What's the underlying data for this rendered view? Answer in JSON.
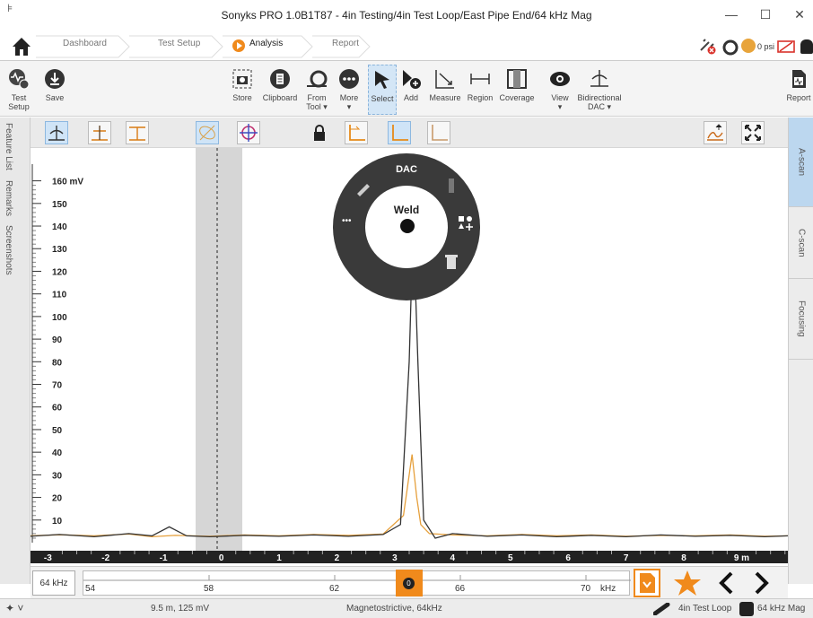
{
  "window": {
    "title": "Sonyks PRO 1.0B1T87 - 4in Testing/4in Test Loop/East Pipe End/64 kHz Mag",
    "system_menu_glyph": "̅"
  },
  "nav": {
    "home_icon": "home-icon",
    "crumbs": [
      "Dashboard",
      "Test Setup",
      "Analysis",
      "Report"
    ],
    "active": "Analysis",
    "pressure": "0 psi"
  },
  "ribbon": {
    "left": [
      {
        "label": "Test\nSetup",
        "icon": "test-setup-icon"
      },
      {
        "label": "Save",
        "icon": "save-icon"
      }
    ],
    "middle": [
      {
        "label": "Store",
        "icon": "store-icon"
      },
      {
        "label": "Clipboard",
        "icon": "clipboard-icon"
      },
      {
        "label": "From\nTool ▾",
        "icon": "from-tool-icon"
      },
      {
        "label": "More\n▾",
        "icon": "more-icon"
      },
      {
        "label": "Select",
        "icon": "select-icon"
      },
      {
        "label": "Add",
        "icon": "add-icon"
      },
      {
        "label": "Measure",
        "icon": "measure-icon"
      },
      {
        "label": "Region",
        "icon": "region-icon"
      },
      {
        "label": "Coverage",
        "icon": "coverage-icon"
      },
      {
        "label": "View\n▾",
        "icon": "view-icon"
      },
      {
        "label": "Bidirectional\nDAC ▾",
        "icon": "dac-icon"
      }
    ],
    "right": [
      {
        "label": "Report",
        "icon": "report-icon"
      }
    ]
  },
  "side_tabs": {
    "left": [
      "Feature List",
      "Remarks",
      "Screenshots"
    ],
    "right": [
      "A-scan",
      "C-scan",
      "Focusing"
    ]
  },
  "chart_data": {
    "type": "line",
    "ylabel": "",
    "yunit": "mV",
    "yticks": [
      10,
      20,
      30,
      40,
      50,
      60,
      70,
      80,
      90,
      100,
      110,
      120,
      130,
      140,
      150,
      160
    ],
    "ylim": [
      0,
      165
    ],
    "xunit": "m",
    "xticks": [
      -3,
      -2,
      -1,
      0,
      1,
      2,
      3,
      4,
      5,
      6,
      7,
      8,
      9
    ],
    "xlim": [
      -3.3,
      9.8
    ],
    "series": [
      {
        "color": "#e6a03c",
        "x": [
          -3.3,
          -2.8,
          -2.2,
          -1.6,
          -1.2,
          -0.8,
          -0.2,
          0.4,
          1,
          1.6,
          2.2,
          2.8,
          3.15,
          3.3,
          3.38,
          3.45,
          3.6,
          4,
          4.6,
          5.2,
          5.8,
          6.4,
          7,
          7.6,
          8.2,
          8.8,
          9.4,
          9.8
        ],
        "y": [
          3,
          3.5,
          3,
          3.8,
          2.6,
          3.2,
          2.8,
          3.4,
          3,
          3.6,
          3.2,
          3.8,
          12,
          39,
          20,
          8,
          4,
          3.4,
          3,
          3.6,
          3,
          3.4,
          2.8,
          3.2,
          3,
          3.4,
          2.8,
          3
        ]
      },
      {
        "color": "#333333",
        "x": [
          -3.3,
          -2.8,
          -2.2,
          -1.6,
          -1.2,
          -0.9,
          -0.6,
          -0.2,
          0.4,
          1,
          1.6,
          2.2,
          2.8,
          3.1,
          3.25,
          3.32,
          3.4,
          3.5,
          3.7,
          4,
          4.6,
          5.2,
          5.8,
          6.4,
          7,
          7.6,
          8.2,
          8.8,
          9.4,
          9.8
        ],
        "y": [
          2.8,
          3.6,
          2.6,
          4,
          3,
          7,
          3,
          2.6,
          3.2,
          2.8,
          3.4,
          2.8,
          3.6,
          8,
          80,
          142,
          80,
          10,
          2,
          4,
          2.8,
          3.4,
          2.6,
          3.2,
          2.6,
          3.4,
          2.8,
          3.2,
          2.6,
          3
        ]
      }
    ]
  },
  "context_menu": {
    "title": "DAC",
    "center": "Weld",
    "more": "•••"
  },
  "frequency_bar": {
    "label": "64 kHz",
    "scale_start": "54",
    "ticks": [
      "58",
      "62",
      "66",
      "70"
    ],
    "unit": "kHz",
    "marker": "0"
  },
  "status": {
    "position": "9.5 m, 125 mV",
    "mode": "Magnetostrictive, 64kHz",
    "loop": "4in Test Loop",
    "mag": "64 kHz Mag"
  }
}
